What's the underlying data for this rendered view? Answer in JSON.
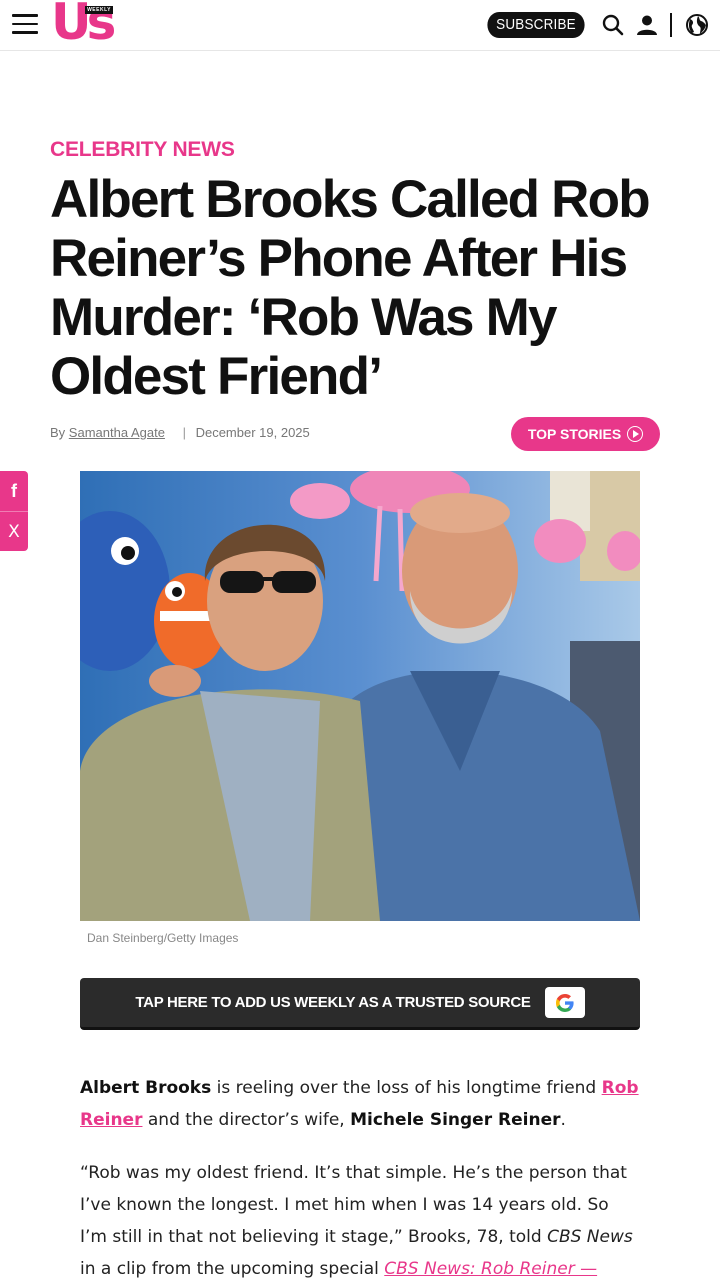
{
  "header": {
    "logo_text": "Us",
    "logo_badge": "WEEKLY",
    "subscribe_label": "SUBSCRIBE",
    "icons": [
      "menu-icon",
      "search-icon",
      "account-icon",
      "globe-icon"
    ]
  },
  "social": {
    "facebook_glyph": "f",
    "x_glyph": "X"
  },
  "article": {
    "category": "CELEBRITY NEWS",
    "headline": "Albert Brooks Called Rob Reiner’s Phone After His Murder: ‘Rob Was My Oldest Friend’",
    "byline_prefix": "By",
    "author": "Samantha Agate",
    "date": "December 19, 2025",
    "top_stories_label": "TOP STORIES",
    "photo_caption": "Dan Steinberg/Getty Images",
    "trusted_source_label": "TAP HERE TO ADD US WEEKLY AS A TRUSTED SOURCE",
    "p1": {
      "name1": "Albert Brooks",
      "text1": " is reeling over the loss of his longtime friend ",
      "link1": "Rob Reiner",
      "text2": " and the director’s wife, ",
      "name2": "Michele Singer Reiner",
      "text3": "."
    },
    "p2": {
      "text1": "“Rob was my oldest friend. It’s that simple. He’s the person that I’ve known the longest. I met him when I was 14 years old. So I’m still in that not believing it stage,” Brooks, 78, told ",
      "source": "CBS News",
      "text2": " in a clip from the upcoming special ",
      "link": "CBS News: Rob Reiner — Scenes From a Life"
    }
  },
  "colors": {
    "brand_pink": "#e8378a",
    "dark_button": "#2b2b2b"
  }
}
